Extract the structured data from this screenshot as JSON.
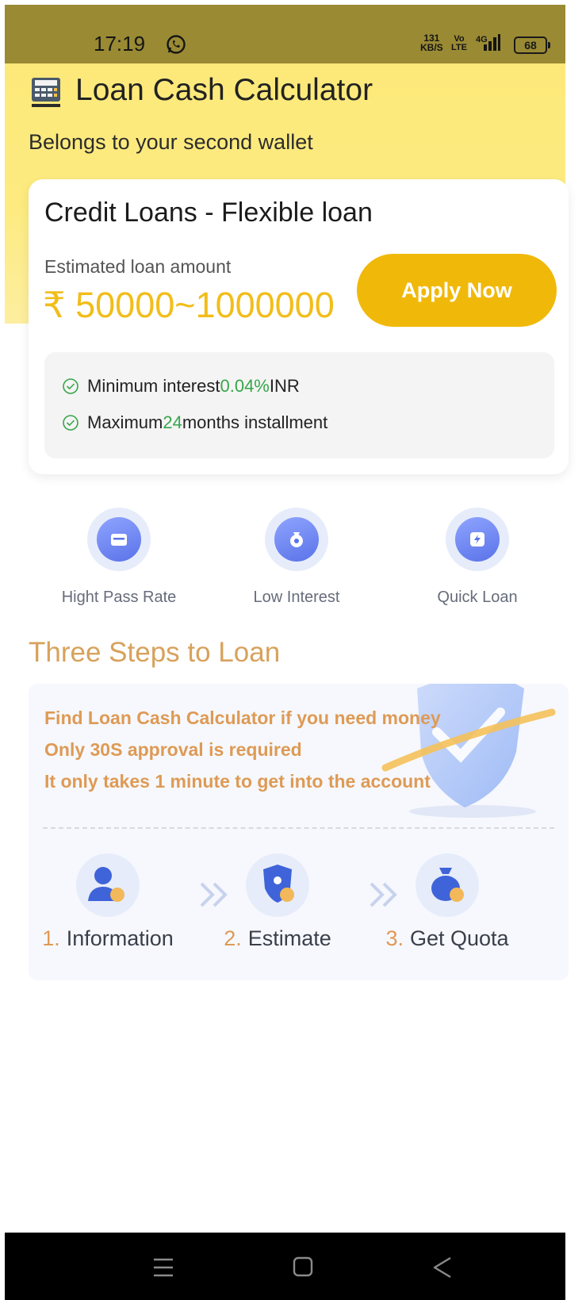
{
  "status_bar": {
    "time": "17:19",
    "speed_value": "131",
    "speed_unit": "KB/S",
    "volte_top": "Vo",
    "volte_bottom": "LTE",
    "network": "4G",
    "battery": "68",
    "icons": [
      "whatsapp-icon",
      "signal-icon",
      "battery-icon"
    ]
  },
  "header": {
    "title": "Loan Cash Calculator",
    "subtitle": "Belongs to your second wallet",
    "background": "#fde97a"
  },
  "loan_card": {
    "title": "Credit Loans - Flexible loan",
    "estimate_label": "Estimated loan amount",
    "amount": "₹ 50000~1000000",
    "apply_label": "Apply Now",
    "accent": "#f0b90a",
    "perks": [
      {
        "prefix": "Minimum interest ",
        "highlight": "0.04%",
        "suffix": " INR"
      },
      {
        "prefix": "Maximum ",
        "highlight": "24",
        "suffix": " months installment"
      }
    ]
  },
  "features": [
    {
      "icon": "wallet-icon",
      "label": "Hight Pass Rate"
    },
    {
      "icon": "money-bag-icon",
      "label": "Low Interest"
    },
    {
      "icon": "lightning-icon",
      "label": "Quick Loan"
    }
  ],
  "steps_section": {
    "title": "Three Steps to Loan",
    "lines": [
      "Find Loan Cash Calculator if you need money",
      "Only 30S approval is required",
      "It only takes 1 minute to get into the account"
    ],
    "steps": [
      {
        "num": "1.",
        "label": "Information",
        "icon": "user-icon"
      },
      {
        "num": "2.",
        "label": "Estimate",
        "icon": "shield-check-icon"
      },
      {
        "num": "3.",
        "label": "Get Quota",
        "icon": "money-bag-icon"
      }
    ]
  },
  "nav_bar": {
    "icons": [
      "menu-icon",
      "home-icon",
      "back-icon"
    ]
  }
}
